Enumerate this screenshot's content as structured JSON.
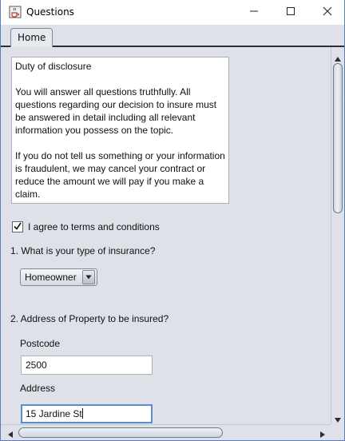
{
  "window": {
    "title": "Questions"
  },
  "tabs": [
    {
      "label": "Home"
    }
  ],
  "disclosure": {
    "heading": "Duty of disclosure",
    "paragraph1": "You will answer all questions truthfully. All questions regarding our decision to insure must be answered in detail including all relevant information you possess on the topic.",
    "paragraph2": "If you do not tell us something or your information is fraudulent, we may cancel your contract or reduce the amount we will pay if you make a claim."
  },
  "agree": {
    "label": "I agree to terms and conditions",
    "checked": true
  },
  "question1": {
    "label": "1. What is your type of insurance?",
    "selected": "Homeowner"
  },
  "question2": {
    "label": "2. Address of Property to be insured?",
    "postcode_label": "Postcode",
    "postcode_value": "2500",
    "address_label": "Address",
    "address_value": "15 Jardine St"
  },
  "icons": {
    "app": "java-cup-icon",
    "minimize": "minimize-icon",
    "maximize": "maximize-icon",
    "close": "close-icon",
    "check": "checkmark-icon",
    "dropdown": "triangle-down-icon",
    "scroll_up": "scroll-up-arrow-icon",
    "scroll_down": "scroll-down-arrow-icon",
    "scroll_left": "scroll-left-arrow-icon",
    "scroll_right": "scroll-right-arrow-icon"
  },
  "colors": {
    "panel_bg": "#dfe1e8",
    "focus_border": "#5f8bc6",
    "window_border": "#5b7cc0"
  }
}
